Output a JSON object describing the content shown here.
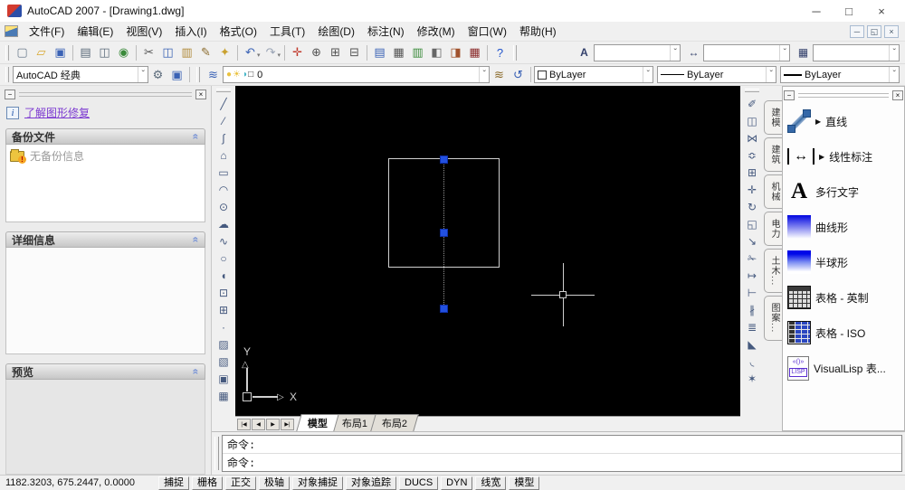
{
  "window": {
    "title": "AutoCAD 2007 - [Drawing1.dwg]",
    "controls": [
      {
        "name": "minimize-button",
        "g": "─"
      },
      {
        "name": "maximize-button",
        "g": "□"
      },
      {
        "name": "close-button",
        "g": "×"
      }
    ]
  },
  "menubar": {
    "items": [
      "文件(F)",
      "编辑(E)",
      "视图(V)",
      "插入(I)",
      "格式(O)",
      "工具(T)",
      "绘图(D)",
      "标注(N)",
      "修改(M)",
      "窗口(W)",
      "帮助(H)"
    ],
    "child_controls": [
      {
        "name": "child-minimize-button",
        "g": "─"
      },
      {
        "name": "child-restore-button",
        "g": "◱"
      },
      {
        "name": "child-close-button",
        "g": "×"
      }
    ]
  },
  "toolbar1": {
    "icons": [
      {
        "name": "new-icon",
        "g": "▢",
        "c": "#6b7b8d"
      },
      {
        "name": "open-icon",
        "g": "▱",
        "c": "#d8a72e"
      },
      {
        "name": "save-icon",
        "g": "▣",
        "c": "#3a62b5"
      },
      {
        "sep": true
      },
      {
        "name": "plot-icon",
        "g": "▤",
        "c": "#5a6a7a"
      },
      {
        "name": "plot-preview-icon",
        "g": "◫",
        "c": "#5a6a7a"
      },
      {
        "name": "publish-icon",
        "g": "◉",
        "c": "#3a8a3a"
      },
      {
        "sep": true
      },
      {
        "name": "cut-icon",
        "g": "✂",
        "c": "#555555"
      },
      {
        "name": "copy-icon",
        "g": "◫",
        "c": "#3a62b5"
      },
      {
        "name": "paste-icon",
        "g": "▥",
        "c": "#b08a3a"
      },
      {
        "name": "match-properties-icon",
        "g": "✎",
        "c": "#8a6a2a"
      },
      {
        "name": "block-editor-icon",
        "g": "✦",
        "c": "#c9a12f"
      },
      {
        "sep": true
      },
      {
        "name": "undo-icon",
        "g": "↶",
        "c": "#3a62b5",
        "dd": "▾"
      },
      {
        "name": "redo-icon",
        "g": "↷",
        "c": "#9aa4b5",
        "dd": "▾"
      },
      {
        "sep": true
      },
      {
        "name": "pan-icon",
        "g": "✛",
        "c": "#c0392b"
      },
      {
        "name": "zoom-realtime-icon",
        "g": "⊕",
        "c": "#555555"
      },
      {
        "name": "zoom-window-icon",
        "g": "⊞",
        "c": "#555555"
      },
      {
        "name": "zoom-previous-icon",
        "g": "⊟",
        "c": "#555555"
      },
      {
        "sep": true
      },
      {
        "name": "properties-icon",
        "g": "▤",
        "c": "#3a62b5"
      },
      {
        "name": "designcenter-icon",
        "g": "▦",
        "c": "#555555"
      },
      {
        "name": "tool-palettes-icon",
        "g": "▥",
        "c": "#3a8a3a"
      },
      {
        "name": "sheet-set-manager-icon",
        "g": "◧",
        "c": "#666666"
      },
      {
        "name": "markup-set-manager-icon",
        "g": "◨",
        "c": "#a0522d"
      },
      {
        "name": "quickcalc-icon",
        "g": "▦",
        "c": "#8a2a2a"
      },
      {
        "sep": true
      },
      {
        "name": "help-icon",
        "g": "?",
        "c": "#2255cc"
      }
    ],
    "style_combos": [
      {
        "name": "text-style-combo",
        "icon_name": "text-style-icon",
        "icon": "A",
        "value": ""
      },
      {
        "name": "dim-style-combo",
        "icon_name": "dim-style-icon",
        "icon": "↔",
        "value": ""
      },
      {
        "name": "table-style-combo",
        "icon_name": "table-style-icon",
        "icon": "▦",
        "value": ""
      }
    ]
  },
  "toolbar2": {
    "workspace": {
      "value": "AutoCAD 经典"
    },
    "workspace_icons": [
      {
        "name": "workspace-settings-icon",
        "g": "⚙",
        "c": "#5a6a7a"
      },
      {
        "name": "save-workspace-icon",
        "g": "▣",
        "c": "#3a62b5"
      }
    ],
    "layers_dialog_icon": {
      "name": "layer-properties-icon",
      "g": "≋",
      "c": "#3a62b5"
    },
    "layer_combo": {
      "icons": [
        {
          "name": "layer-on-icon",
          "g": "●",
          "c": "#eac23f"
        },
        {
          "name": "layer-thaw-icon",
          "g": "☀",
          "c": "#eac23f"
        },
        {
          "name": "layer-lock-icon",
          "g": "◑",
          "c": "#49b7c9"
        },
        {
          "name": "layer-color-swatch",
          "g": "□",
          "c": "#333333"
        }
      ],
      "value": "0"
    },
    "layer_tail_icons": [
      {
        "name": "layer-states-icon",
        "g": "≋",
        "c": "#8a6a2a"
      },
      {
        "name": "layer-previous-icon",
        "g": "↺",
        "c": "#3a62b5"
      }
    ],
    "color_combo": {
      "value": "ByLayer"
    },
    "linetype_combo": {
      "value": "ByLayer"
    },
    "lineweight_combo": {
      "value": "ByLayer"
    }
  },
  "left_panel": {
    "grab": {
      "collapse": "−",
      "close": "×"
    },
    "info_glyph": "i",
    "link_label": "了解图形修复",
    "backup": {
      "title": "备份文件",
      "item_label": "无备份信息",
      "warn_glyph": "!"
    },
    "details": {
      "title": "详细信息"
    },
    "preview": {
      "title": "预览"
    }
  },
  "draw_toolbar": {
    "icons": [
      {
        "name": "line-icon",
        "g": "╱"
      },
      {
        "name": "construction-line-icon",
        "g": "⁄"
      },
      {
        "name": "polyline-icon",
        "g": "∫"
      },
      {
        "name": "polygon-icon",
        "g": "⌂"
      },
      {
        "name": "rectangle-icon",
        "g": "▭"
      },
      {
        "name": "arc-icon",
        "g": "◠"
      },
      {
        "name": "circle-icon",
        "g": "⊙"
      },
      {
        "name": "revision-cloud-icon",
        "g": "☁"
      },
      {
        "name": "spline-icon",
        "g": "∿"
      },
      {
        "name": "ellipse-icon",
        "g": "○"
      },
      {
        "name": "ellipse-arc-icon",
        "g": "◖"
      },
      {
        "name": "insert-block-icon",
        "g": "⊡"
      },
      {
        "name": "make-block-icon",
        "g": "⊞"
      },
      {
        "name": "point-icon",
        "g": "·"
      },
      {
        "name": "hatch-icon",
        "g": "▨"
      },
      {
        "name": "gradient-icon",
        "g": "▧"
      },
      {
        "name": "region-icon",
        "g": "▣"
      },
      {
        "name": "table-icon",
        "g": "▦"
      }
    ]
  },
  "modify_toolbar": {
    "icons": [
      {
        "name": "erase-icon",
        "g": "✐"
      },
      {
        "name": "copy-object-icon",
        "g": "◫"
      },
      {
        "name": "mirror-icon",
        "g": "⋈"
      },
      {
        "name": "offset-icon",
        "g": "≎"
      },
      {
        "name": "array-icon",
        "g": "⊞"
      },
      {
        "name": "move-icon",
        "g": "✛"
      },
      {
        "name": "rotate-icon",
        "g": "↻"
      },
      {
        "name": "scale-icon",
        "g": "◱"
      },
      {
        "name": "stretch-icon",
        "g": "↘"
      },
      {
        "name": "trim-icon",
        "g": "✁"
      },
      {
        "name": "extend-icon",
        "g": "↦"
      },
      {
        "name": "break-at-point-icon",
        "g": "⊢"
      },
      {
        "name": "break-icon",
        "g": "∦"
      },
      {
        "name": "join-icon",
        "g": "≣"
      },
      {
        "name": "chamfer-icon",
        "g": "◣"
      },
      {
        "name": "fillet-icon",
        "g": "◟"
      },
      {
        "name": "explode-icon",
        "g": "✶"
      }
    ]
  },
  "palette": {
    "grab": {
      "collapse": "−",
      "close": "×"
    },
    "tabs": [
      "建模",
      "建筑",
      "机械",
      "电力",
      "土木...",
      "图案..."
    ],
    "items": [
      {
        "icon": "line-3d-icon",
        "label": "直线",
        "flyout_glyph": "▶"
      },
      {
        "icon": "linear-dim-icon",
        "label": "线性标注",
        "flyout_glyph": "▶"
      },
      {
        "icon": "mtext-icon",
        "icon_text": "A",
        "label": "多行文字"
      },
      {
        "icon": "gradient-curve-icon",
        "label": "曲线形"
      },
      {
        "icon": "gradient-hemisphere-icon",
        "label": "半球形"
      },
      {
        "icon": "table-imperial-icon",
        "label": "表格 - 英制"
      },
      {
        "icon": "table-iso-icon",
        "label": "表格 - ISO"
      },
      {
        "icon": "visuallisp-icon",
        "icon_text": "LISP",
        "label": "VisualLisp 表..."
      }
    ]
  },
  "canvas": {
    "ucs_x_label": "X",
    "ucs_y_label": "Y",
    "ucs_y_arrow": "△",
    "ucs_x_arrow": "▷"
  },
  "layout_tabs": {
    "nav": [
      {
        "name": "first-tab-button",
        "g": "|◀"
      },
      {
        "name": "prev-tab-button",
        "g": "◀"
      },
      {
        "name": "next-tab-button",
        "g": "▶"
      },
      {
        "name": "last-tab-button",
        "g": "▶|"
      }
    ],
    "tabs": [
      {
        "label": "模型",
        "active": true
      },
      {
        "label": "布局1"
      },
      {
        "label": "布局2"
      }
    ]
  },
  "command": {
    "history_line": "命令:",
    "input_line": "命令:"
  },
  "status_bar": {
    "coords": "1182.3203, 675.2447, 0.0000",
    "buttons": [
      "捕捉",
      "栅格",
      "正交",
      "极轴",
      "对象捕捉",
      "对象追踪",
      "DUCS",
      "DYN",
      "线宽",
      "模型"
    ]
  },
  "ui": {
    "combo_arrow": "ˇ",
    "section_chevron": "«"
  },
  "colors": {
    "canvas_bg": "#000000",
    "grip_blue": "#2250e0",
    "crosshair": "#cfcfcf",
    "link_purple": "#7d3bd1",
    "accent_blue": "#3a62b5"
  }
}
